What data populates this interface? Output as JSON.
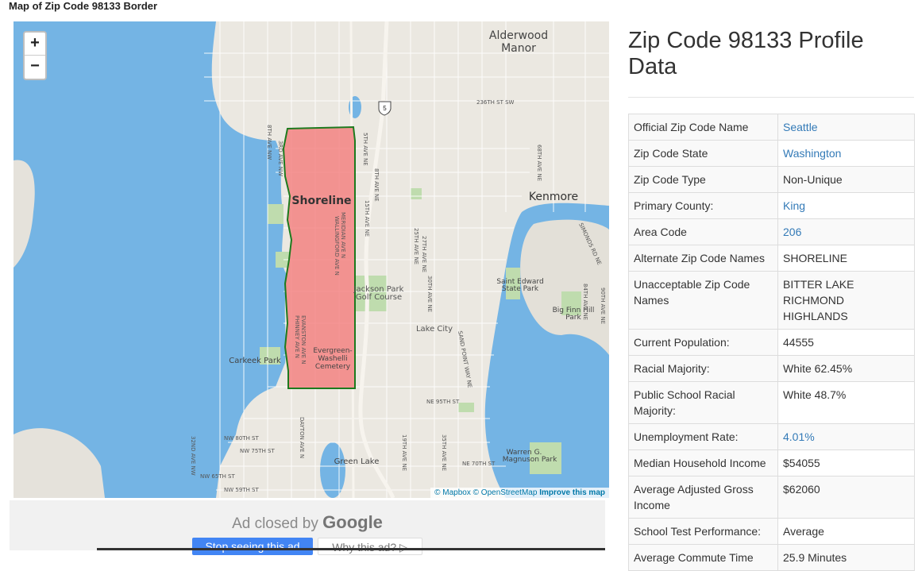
{
  "map_title": "Map of Zip Code 98133 Border",
  "map": {
    "zoom_in": "+",
    "zoom_out": "−",
    "places": {
      "alderwood": "Alderwood",
      "manor": "Manor",
      "kenmore": "Kenmore",
      "shoreline": "Shoreline",
      "jackson_park": "Jackson Park",
      "golf_course": "Golf Course",
      "lake_city": "Lake City",
      "saint_edward": "Saint Edward",
      "state_park": "State Park",
      "big_finn": "Big Finn Hill",
      "park": "Park",
      "carkeek": "Carkeek Park",
      "evergreen": "Evergreen-",
      "washelli": "Washelli",
      "cemetery": "Cemetery",
      "green_lake": "Green Lake",
      "warren": "Warren G.",
      "magnuson": "Magnuson Park"
    },
    "streets": {
      "s236": "236TH ST SW",
      "ne95": "NE 95TH ST",
      "nw80": "NW 80TH ST",
      "nw75": "NW 75TH ST",
      "nw65": "NW 65TH ST",
      "nw59": "NW 59TH ST",
      "ne70": "NE 70TH ST",
      "meridian": "MERIDIAN AVE N",
      "wallingford": "WALLINGFORD AVE N",
      "evanston": "EVANSTON AVE N",
      "phinney": "PHINNEY AVE N",
      "dayton": "DAYTON AVE N",
      "sand_point": "SAND POINT WAY NE",
      "simonds": "SIMONDS RD NE",
      "ave5": "5TH AVE NE",
      "ave8": "8TH AVE NE",
      "ave15": "15TH AVE NE",
      "ave25": "25TH AVE NE",
      "ave27": "27TH AVE NE",
      "ave30": "30TH AVE NE",
      "ave35": "35TH AVE NE",
      "ave19": "19TH AVE NE",
      "ave3nw": "3RD AVE NW",
      "ave8nw": "8TH AVE NW",
      "ave32nw": "32ND AVE NW",
      "ave68": "68TH AVE NE",
      "ave84": "84TH AVE NE",
      "ave90": "90TH AVE NE",
      "hwy": "5"
    },
    "attribution": {
      "mapbox": "© Mapbox",
      "osm": "© OpenStreetMap",
      "improve": "Improve this map"
    }
  },
  "ad": {
    "closed_text": "Ad closed by",
    "google": "Google",
    "stop_button": "Stop seeing this ad",
    "why_button": "Why this ad? ▷"
  },
  "profile": {
    "title": "Zip Code 98133 Profile Data",
    "rows": [
      {
        "label": "Official Zip Code Name",
        "value": "Seattle",
        "link": true
      },
      {
        "label": "Zip Code State",
        "value": "Washington",
        "link": true
      },
      {
        "label": "Zip Code Type",
        "value": "Non-Unique",
        "link": false
      },
      {
        "label": "Primary County:",
        "value": "King",
        "link": true
      },
      {
        "label": "Area Code",
        "value": "206",
        "link": true
      },
      {
        "label": "Alternate Zip Code Names",
        "value": "SHORELINE",
        "link": false
      },
      {
        "label": "Unacceptable Zip Code Names",
        "value": "BITTER LAKE\nRICHMOND HIGHLANDS",
        "link": false
      },
      {
        "label": "Current Population:",
        "value": "44555",
        "link": false
      },
      {
        "label": "Racial Majority:",
        "value": "White 62.45%",
        "link": false
      },
      {
        "label": "Public School Racial Majority:",
        "value": "White 48.7%",
        "link": false
      },
      {
        "label": "Unemployment Rate:",
        "value": "4.01%",
        "link": true
      },
      {
        "label": "Median Household Income",
        "value": "$54055",
        "link": false
      },
      {
        "label": "Average Adjusted Gross Income",
        "value": "$62060",
        "link": false
      },
      {
        "label": "School Test Performance:",
        "value": "Average",
        "link": false
      },
      {
        "label": "Average Commute Time",
        "value": "25.9 Minutes",
        "link": false
      }
    ]
  }
}
